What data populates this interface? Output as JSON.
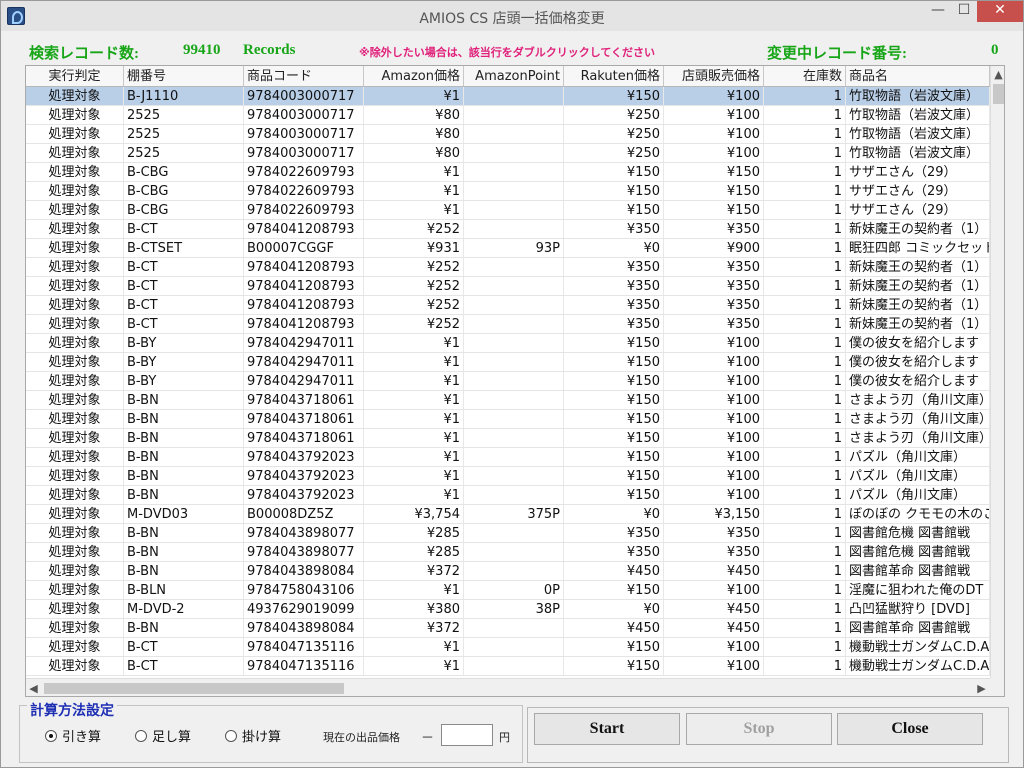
{
  "window": {
    "title": "AMIOS CS 店頭一括価格変更",
    "minimize": "—",
    "maximize": "☐",
    "close": "✕"
  },
  "info": {
    "search_label": "検索レコード数:",
    "search_count": "99410",
    "records_label": "Records",
    "note": "※除外したい場合は、該当行をダブルクリックしてください",
    "changing_label": "変更中レコード番号:",
    "changing_value": "0"
  },
  "grid": {
    "columns": [
      "実行判定",
      "棚番号",
      "商品コード",
      "Amazon価格",
      "AmazonPoint",
      "Rakuten価格",
      "店頭販売価格",
      "在庫数",
      "商品名"
    ],
    "rows": [
      [
        "処理対象",
        "B-J1110",
        "9784003000717",
        "¥1",
        "",
        "¥150",
        "¥100",
        "1",
        "竹取物語（岩波文庫）"
      ],
      [
        "処理対象",
        "2525",
        "9784003000717",
        "¥80",
        "",
        "¥250",
        "¥100",
        "1",
        "竹取物語（岩波文庫）"
      ],
      [
        "処理対象",
        "2525",
        "9784003000717",
        "¥80",
        "",
        "¥250",
        "¥100",
        "1",
        "竹取物語（岩波文庫）"
      ],
      [
        "処理対象",
        "2525",
        "9784003000717",
        "¥80",
        "",
        "¥250",
        "¥100",
        "1",
        "竹取物語（岩波文庫）"
      ],
      [
        "処理対象",
        "B-CBG",
        "9784022609793",
        "¥1",
        "",
        "¥150",
        "¥150",
        "1",
        "サザエさん（29）"
      ],
      [
        "処理対象",
        "B-CBG",
        "9784022609793",
        "¥1",
        "",
        "¥150",
        "¥150",
        "1",
        "サザエさん（29）"
      ],
      [
        "処理対象",
        "B-CBG",
        "9784022609793",
        "¥1",
        "",
        "¥150",
        "¥150",
        "1",
        "サザエさん（29）"
      ],
      [
        "処理対象",
        "B-CT",
        "9784041208793",
        "¥252",
        "",
        "¥350",
        "¥350",
        "1",
        "新妹魔王の契約者（1）"
      ],
      [
        "処理対象",
        "B-CTSET",
        "B00007CGGF",
        "¥931",
        "93P",
        "¥0",
        "¥900",
        "1",
        "眠狂四郎 コミックセット"
      ],
      [
        "処理対象",
        "B-CT",
        "9784041208793",
        "¥252",
        "",
        "¥350",
        "¥350",
        "1",
        "新妹魔王の契約者（1）"
      ],
      [
        "処理対象",
        "B-CT",
        "9784041208793",
        "¥252",
        "",
        "¥350",
        "¥350",
        "1",
        "新妹魔王の契約者（1）"
      ],
      [
        "処理対象",
        "B-CT",
        "9784041208793",
        "¥252",
        "",
        "¥350",
        "¥350",
        "1",
        "新妹魔王の契約者（1）"
      ],
      [
        "処理対象",
        "B-CT",
        "9784041208793",
        "¥252",
        "",
        "¥350",
        "¥350",
        "1",
        "新妹魔王の契約者（1）"
      ],
      [
        "処理対象",
        "B-BY",
        "9784042947011",
        "¥1",
        "",
        "¥150",
        "¥100",
        "1",
        "僕の彼女を紹介します"
      ],
      [
        "処理対象",
        "B-BY",
        "9784042947011",
        "¥1",
        "",
        "¥150",
        "¥100",
        "1",
        "僕の彼女を紹介します"
      ],
      [
        "処理対象",
        "B-BY",
        "9784042947011",
        "¥1",
        "",
        "¥150",
        "¥100",
        "1",
        "僕の彼女を紹介します"
      ],
      [
        "処理対象",
        "B-BN",
        "9784043718061",
        "¥1",
        "",
        "¥150",
        "¥100",
        "1",
        "さまよう刃（角川文庫）"
      ],
      [
        "処理対象",
        "B-BN",
        "9784043718061",
        "¥1",
        "",
        "¥150",
        "¥100",
        "1",
        "さまよう刃（角川文庫）"
      ],
      [
        "処理対象",
        "B-BN",
        "9784043718061",
        "¥1",
        "",
        "¥150",
        "¥100",
        "1",
        "さまよう刃（角川文庫）"
      ],
      [
        "処理対象",
        "B-BN",
        "9784043792023",
        "¥1",
        "",
        "¥150",
        "¥100",
        "1",
        "パズル（角川文庫）"
      ],
      [
        "処理対象",
        "B-BN",
        "9784043792023",
        "¥1",
        "",
        "¥150",
        "¥100",
        "1",
        "パズル（角川文庫）"
      ],
      [
        "処理対象",
        "B-BN",
        "9784043792023",
        "¥1",
        "",
        "¥150",
        "¥100",
        "1",
        "パズル（角川文庫）"
      ],
      [
        "処理対象",
        "M-DVD03",
        "B00008DZ5Z",
        "¥3,754",
        "375P",
        "¥0",
        "¥3,150",
        "1",
        "ぼのぼの クモモの木のこ"
      ],
      [
        "処理対象",
        "B-BN",
        "9784043898077",
        "¥285",
        "",
        "¥350",
        "¥350",
        "1",
        "図書館危機 図書館戦"
      ],
      [
        "処理対象",
        "B-BN",
        "9784043898077",
        "¥285",
        "",
        "¥350",
        "¥350",
        "1",
        "図書館危機 図書館戦"
      ],
      [
        "処理対象",
        "B-BN",
        "9784043898084",
        "¥372",
        "",
        "¥450",
        "¥450",
        "1",
        "図書館革命 図書館戦"
      ],
      [
        "処理対象",
        "B-BLN",
        "9784758043106",
        "¥1",
        "0P",
        "¥150",
        "¥100",
        "1",
        "淫魔に狙われた俺のDT"
      ],
      [
        "処理対象",
        "M-DVD-2",
        "4937629019099",
        "¥380",
        "38P",
        "¥0",
        "¥450",
        "1",
        "凸凹猛獣狩り [DVD]"
      ],
      [
        "処理対象",
        "B-BN",
        "9784043898084",
        "¥372",
        "",
        "¥450",
        "¥450",
        "1",
        "図書館革命 図書館戦"
      ],
      [
        "処理対象",
        "B-CT",
        "9784047135116",
        "¥1",
        "",
        "¥150",
        "¥100",
        "1",
        "機動戦士ガンダムC.D.A"
      ],
      [
        "処理対象",
        "B-CT",
        "9784047135116",
        "¥1",
        "",
        "¥150",
        "¥100",
        "1",
        "機動戦士ガンダムC.D.A"
      ]
    ]
  },
  "calc": {
    "title": "計算方法設定",
    "options": [
      "引き算",
      "足し算",
      "掛け算"
    ],
    "selected": 0,
    "price_label": "現在の出品価格",
    "minus": "－",
    "price_value": "",
    "yen": "円"
  },
  "buttons": {
    "start": "Start",
    "stop": "Stop",
    "close": "Close"
  }
}
